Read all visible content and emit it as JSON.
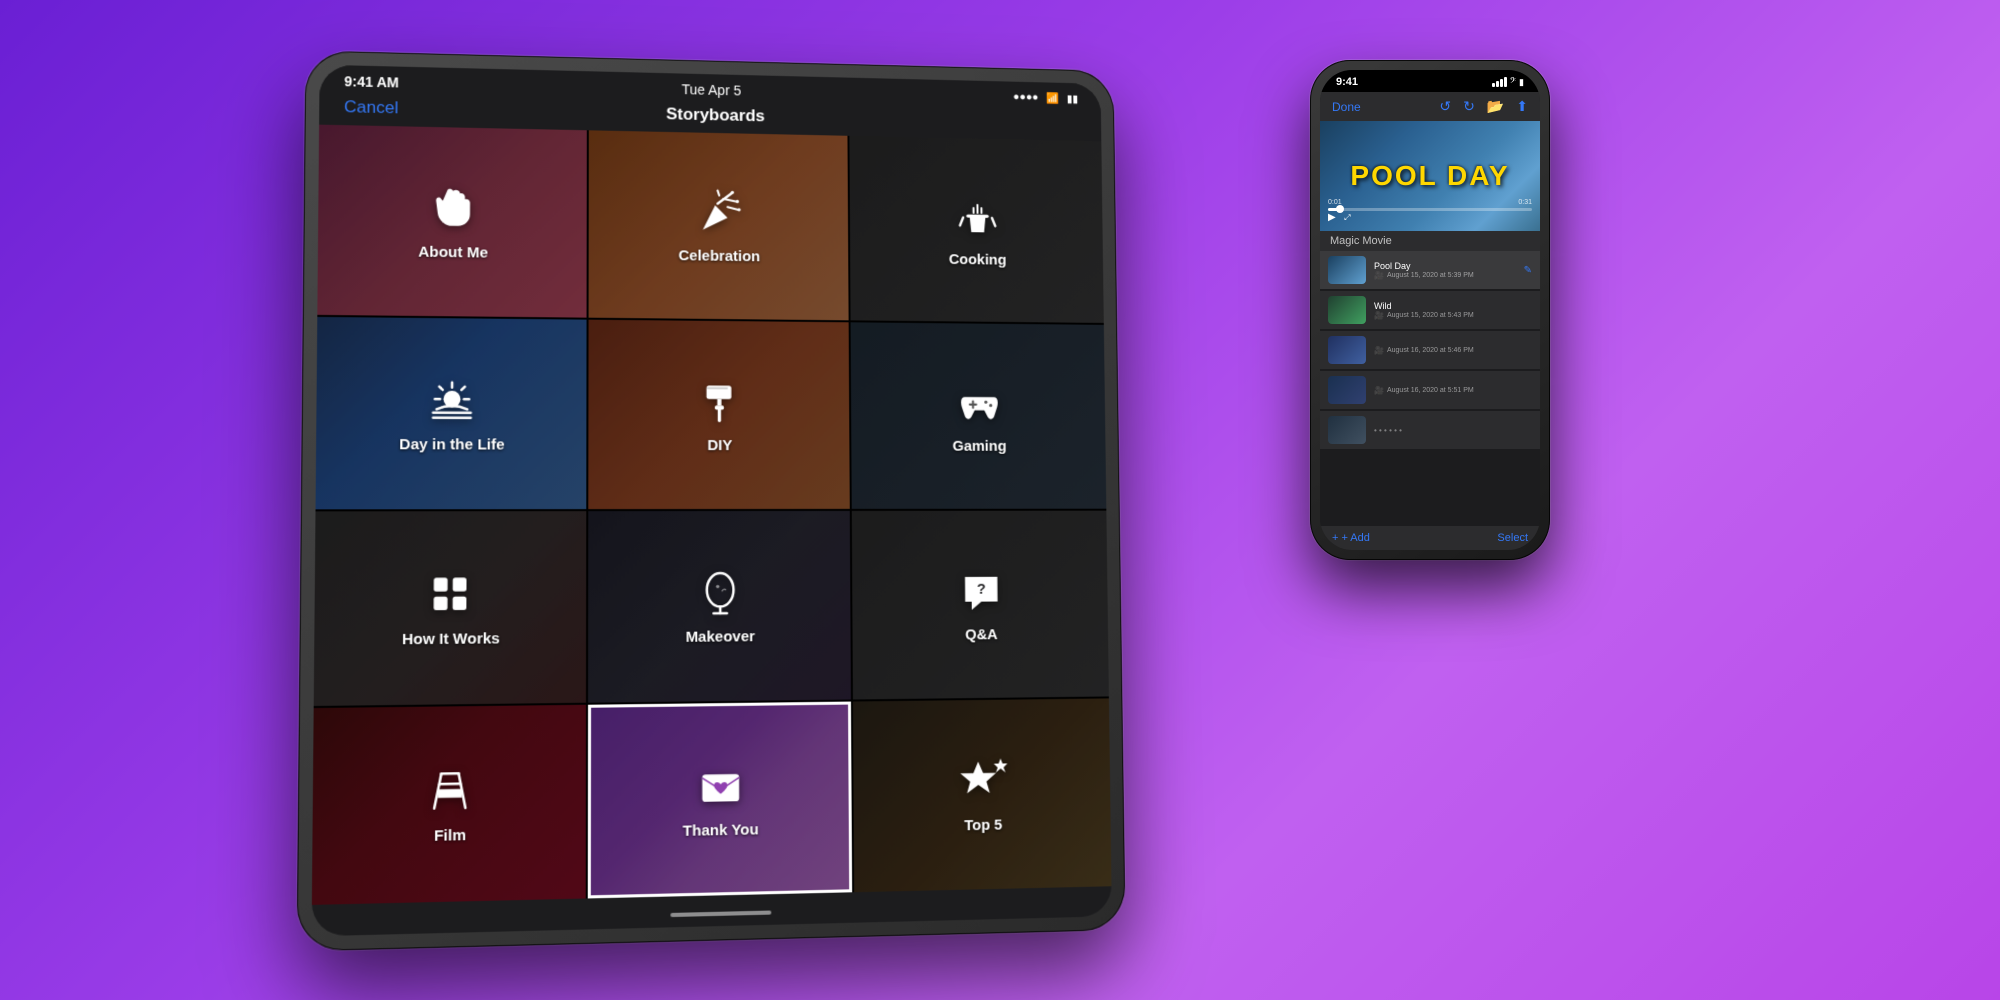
{
  "background": {
    "gradient_start": "#6a1fd4",
    "gradient_end": "#b845e8"
  },
  "ipad": {
    "status_bar": {
      "time": "9:41 AM",
      "date": "Tue Apr 5"
    },
    "nav": {
      "cancel_label": "Cancel",
      "title": "Storyboards"
    },
    "grid_items": [
      {
        "id": "about-me",
        "label": "About Me",
        "icon": "hand-wave",
        "row": 1,
        "col": 1
      },
      {
        "id": "celebration",
        "label": "Celebration",
        "icon": "party-popper",
        "row": 1,
        "col": 2
      },
      {
        "id": "cooking",
        "label": "Cooking",
        "icon": "steam-pot",
        "row": 1,
        "col": 3
      },
      {
        "id": "day-in-the-life",
        "label": "Day in the Life",
        "icon": "sunset",
        "row": 2,
        "col": 1
      },
      {
        "id": "diy",
        "label": "DIY",
        "icon": "paint-roller",
        "row": 2,
        "col": 2
      },
      {
        "id": "gaming",
        "label": "Gaming",
        "icon": "gamepad",
        "row": 2,
        "col": 3
      },
      {
        "id": "how-it-works",
        "label": "How It Works",
        "icon": "modules",
        "row": 3,
        "col": 1
      },
      {
        "id": "makeover",
        "label": "Makeover",
        "icon": "mirror",
        "row": 3,
        "col": 2
      },
      {
        "id": "qa",
        "label": "Q&A",
        "icon": "speech-bubble",
        "row": 3,
        "col": 3
      },
      {
        "id": "film",
        "label": "Film",
        "icon": "director-chair",
        "row": 4,
        "col": 1
      },
      {
        "id": "thank-you",
        "label": "Thank You",
        "icon": "envelope-heart",
        "row": 4,
        "col": 2,
        "selected": true
      },
      {
        "id": "top5",
        "label": "Top 5",
        "icon": "star",
        "row": 4,
        "col": 3
      }
    ]
  },
  "iphone": {
    "status_bar": {
      "time": "9:41",
      "signal": "●●●●",
      "wifi": "wifi",
      "battery": "100%"
    },
    "toolbar": {
      "done_label": "Done"
    },
    "video_preview": {
      "title": "POOL DAY",
      "time_start": "0:01",
      "time_end": "0:31"
    },
    "magic_movie_label": "Magic Movie",
    "movie_list": [
      {
        "id": 1,
        "title": "Pool Day",
        "date": "August 15, 2020 at 5:39 PM",
        "thumb_class": "movie-thumb-1"
      },
      {
        "id": 2,
        "title": "Wild",
        "date": "August 15, 2020 at 5:43 PM",
        "thumb_class": "movie-thumb-2"
      },
      {
        "id": 3,
        "title": "",
        "date": "August 16, 2020 at 5:46 PM",
        "thumb_class": "movie-thumb-3"
      },
      {
        "id": 4,
        "title": "",
        "date": "August 16, 2020 at 5:51 PM",
        "thumb_class": "movie-thumb-4"
      },
      {
        "id": 5,
        "title": "",
        "date": "",
        "thumb_class": "movie-thumb-5"
      }
    ],
    "bottom": {
      "add_label": "+ Add",
      "select_label": "Select"
    }
  }
}
